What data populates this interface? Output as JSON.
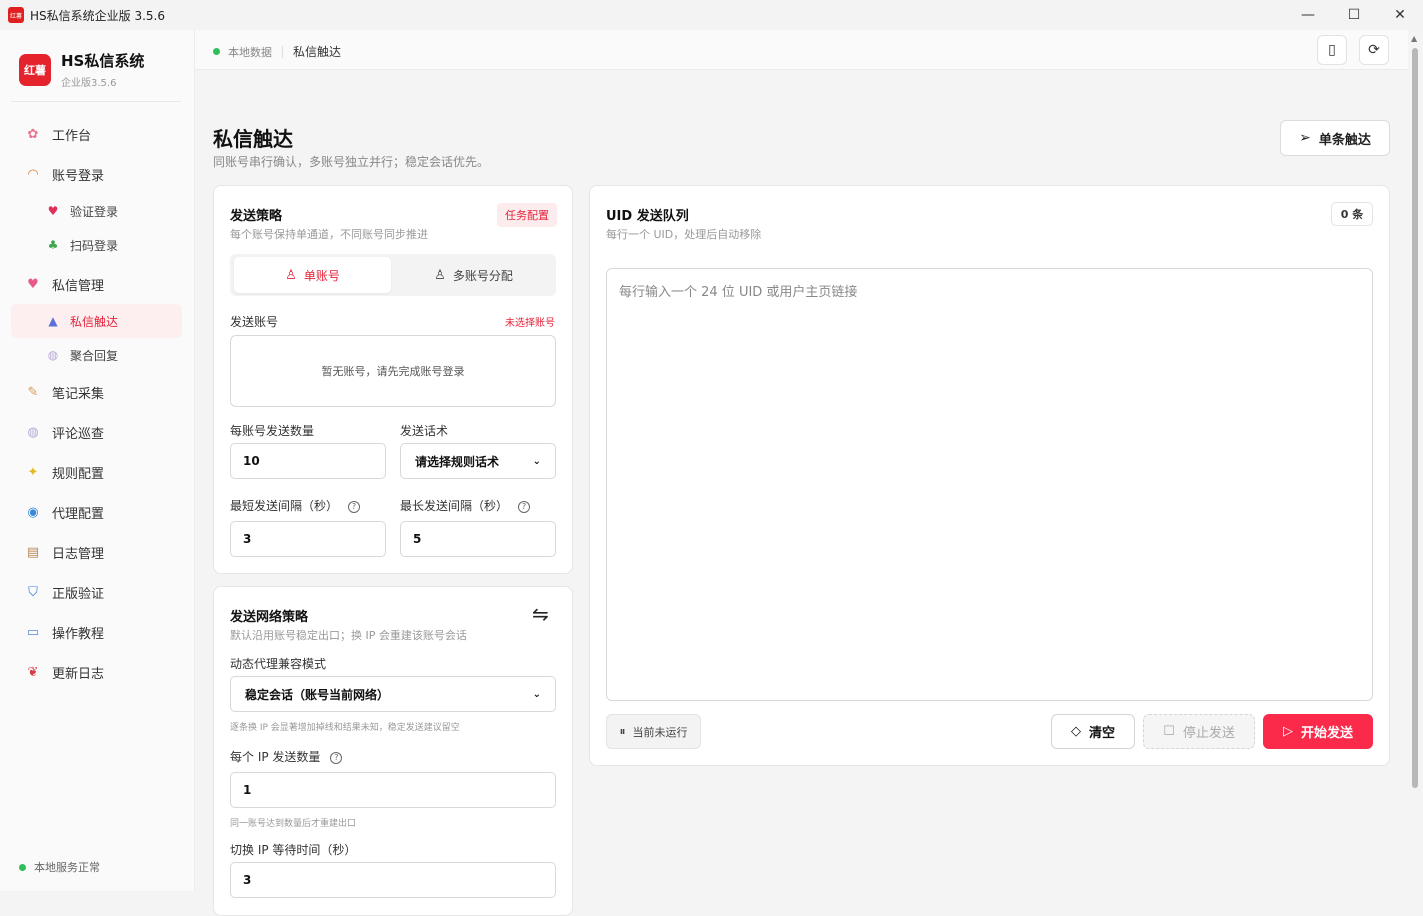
{
  "window": {
    "title": "HS私信系统企业版 3.5.6",
    "logo_text": "红薯"
  },
  "brand": {
    "mark": "红薯",
    "name": "HS私信系统",
    "version": "企业版3.5.6"
  },
  "nav": {
    "workbench": "工作台",
    "account_login": "账号登录",
    "verify_login": "验证登录",
    "qr_login": "扫码登录",
    "dm_manage": "私信管理",
    "dm_reach": "私信触达",
    "aggregate_reply": "聚合回复",
    "note_collect": "笔记采集",
    "comment_patrol": "评论巡查",
    "rule_config": "规则配置",
    "proxy_config": "代理配置",
    "log_manage": "日志管理",
    "license_verify": "正版验证",
    "tutorial": "操作教程",
    "changelog": "更新日志"
  },
  "side_status": "本地服务正常",
  "topbar": {
    "local_data": "本地数据",
    "current": "私信触达"
  },
  "page": {
    "title": "私信触达",
    "subtitle": "同账号串行确认，多账号独立并行；稳定会话优先。",
    "single_btn": "单条触达"
  },
  "strategy": {
    "title": "发送策略",
    "subtitle": "每个账号保持单通道，不同账号同步推进",
    "badge": "任务配置",
    "tab_single": "单账号",
    "tab_multi": "多账号分配",
    "account_label": "发送账号",
    "account_warn": "未选择账号",
    "account_empty": "暂无账号，请先完成账号登录",
    "per_account_label": "每账号发送数量",
    "per_account_value": "10",
    "script_label": "发送话术",
    "script_value": "请选择规则话术",
    "min_interval_label": "最短发送间隔（秒）",
    "min_interval_value": "3",
    "max_interval_label": "最长发送间隔（秒）",
    "max_interval_value": "5"
  },
  "network": {
    "title": "发送网络策略",
    "subtitle": "默认沿用账号稳定出口；换 IP 会重建该账号会话",
    "mode_label": "动态代理兼容模式",
    "mode_value": "稳定会话（账号当前网络）",
    "mode_hint": "逐条换 IP 会显著增加掉线和结果未知，稳定发送建议留空",
    "per_ip_label": "每个 IP 发送数量",
    "per_ip_value": "1",
    "per_ip_hint": "同一账号达到数量后才重建出口",
    "switch_wait_label": "切换 IP 等待时间（秒）",
    "switch_wait_value": "3"
  },
  "queue": {
    "title": "UID 发送队列",
    "subtitle": "每行一个 UID，处理后自动移除",
    "count": "0 条",
    "placeholder": "每行输入一个 24 位 UID 或用户主页链接",
    "status": "当前未运行",
    "clear": "清空",
    "stop": "停止发送",
    "start": "开始发送"
  },
  "colors": {
    "accent": "#e5233a",
    "start_button": "#fb2a4b",
    "ok": "#2dbf5a"
  }
}
